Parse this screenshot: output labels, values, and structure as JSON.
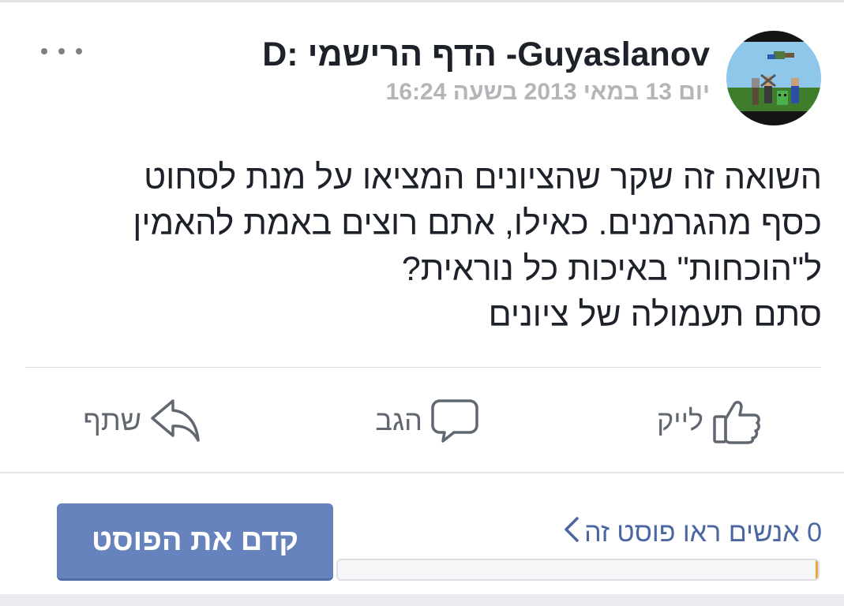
{
  "post": {
    "author": "Guyaslanov- הדף הרישמי :D",
    "timestamp": "יום 13 במאי 2013 בשעה 16:24",
    "body_lines": [
      "השואה זה שקר שהציונים המציאו על מנת לסחוט",
      "כסף מהגרמנים. כאילו, אתם רוצים באמת להאמין",
      "ל\"הוכחות\" באיכות כל נוראית?",
      "סתם תעמולה של ציונים"
    ]
  },
  "actions": {
    "like_label": "לייק",
    "comment_label": "הגב",
    "share_label": "שתף"
  },
  "promo": {
    "reach_text": "0 אנשים ראו פוסט זה",
    "reach_progress": 0,
    "boost_label": "קדם את הפוסט"
  },
  "icons": {
    "menu": "more-dots-icon",
    "like": "thumbs-up-icon",
    "comment": "comment-bubble-icon",
    "share": "share-arrow-icon",
    "reach": "chevron-left-icon"
  },
  "colors": {
    "boost_button": "#6783bd",
    "link": "#4b67a1",
    "progress_fill": "#f1a33f"
  }
}
